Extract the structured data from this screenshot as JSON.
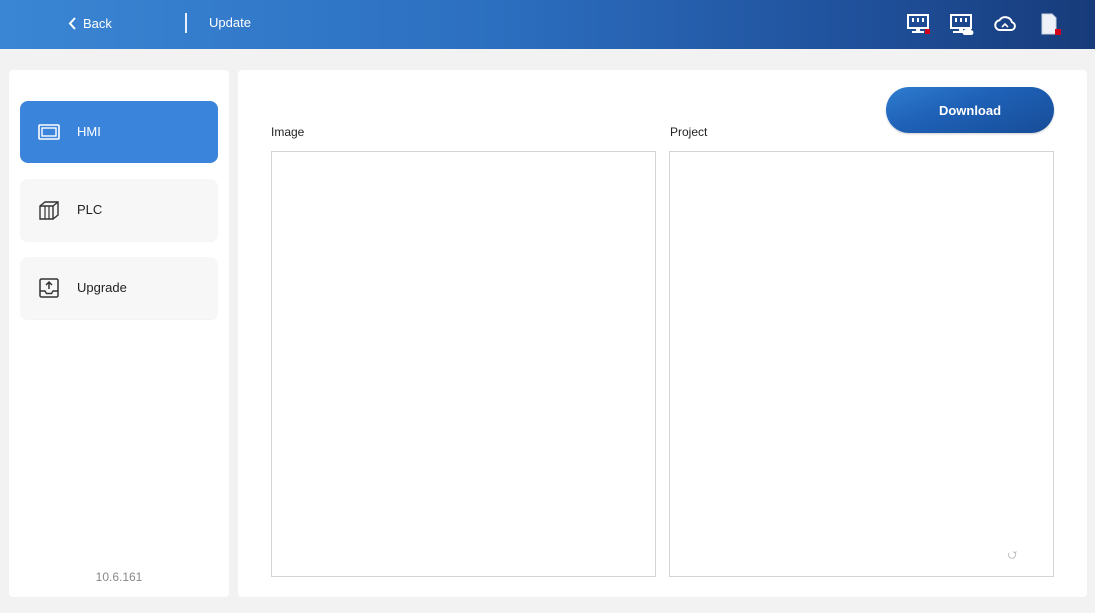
{
  "header": {
    "back_label": "Back",
    "title": "Update",
    "status_icons": [
      "network-port-alert-icon",
      "network-cloud-icon",
      "cloud-icon",
      "sd-card-alert-icon"
    ],
    "alert_color": "#d0021b"
  },
  "sidebar": {
    "items": [
      {
        "label": "HMI",
        "icon": "monitor-icon",
        "active": true
      },
      {
        "label": "PLC",
        "icon": "box-icon",
        "active": false
      },
      {
        "label": "Upgrade",
        "icon": "upload-tray-icon",
        "active": false
      }
    ],
    "version": "10.6.161"
  },
  "main": {
    "download_label": "Download",
    "image_label": "Image",
    "project_label": "Project"
  },
  "colors": {
    "accent": "#3a84dc",
    "header_start": "#3a86d4",
    "header_end": "#173b7a"
  }
}
